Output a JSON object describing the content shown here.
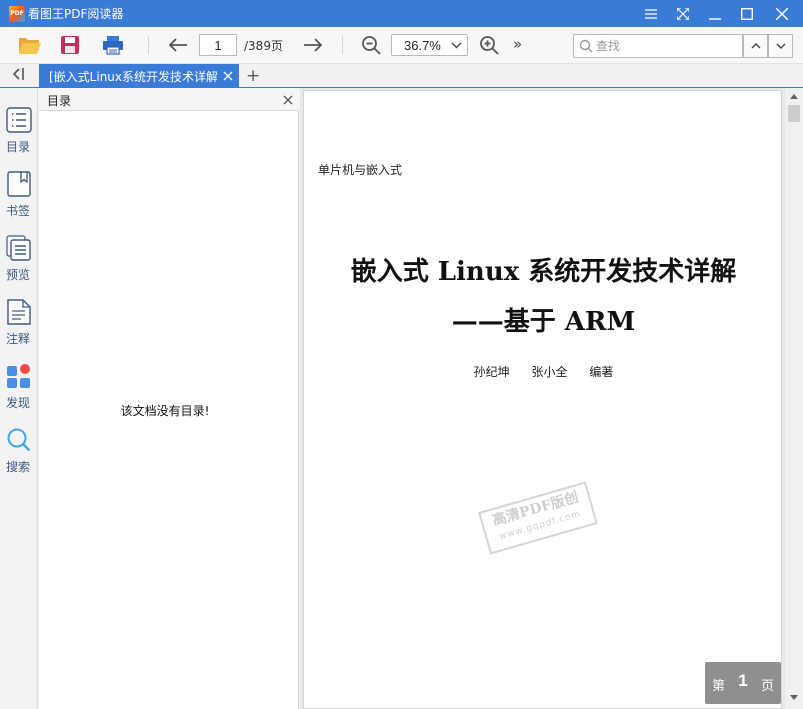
{
  "app": {
    "title": "看图王PDF阅读器",
    "logo_text": "PDF",
    "accent_color": "#3b7bd8"
  },
  "window_controls": [
    "menu-icon",
    "fullscreen-icon",
    "minimize-icon",
    "maximize-icon",
    "close-icon"
  ],
  "toolbar": {
    "icons": [
      "open-folder-icon",
      "save-icon",
      "print-icon",
      "arrow-left-icon",
      "arrow-right-icon",
      "zoom-out-icon",
      "zoom-in-icon"
    ],
    "current_page": "1",
    "total_pages": "/389页",
    "zoom": "36.7%",
    "more": "»",
    "search_placeholder": "查找"
  },
  "tabs": {
    "active_label": "[嵌入式Linux系统开发技术详解:",
    "new_tab": "+"
  },
  "sidebar": {
    "items": [
      {
        "label": "目录",
        "icon": "toc-list-icon"
      },
      {
        "label": "书签",
        "icon": "bookmark-icon"
      },
      {
        "label": "预览",
        "icon": "preview-pages-icon"
      },
      {
        "label": "注释",
        "icon": "annotation-icon"
      },
      {
        "label": "发现",
        "icon": "discover-grid-icon"
      },
      {
        "label": "搜索",
        "icon": "search-icon"
      }
    ]
  },
  "toc_panel": {
    "title": "目录",
    "empty_message": "该文档没有目录!"
  },
  "document": {
    "series": "单片机与嵌入式",
    "title": "嵌入式 Linux 系统开发技术详解",
    "subtitle": "——基于 ARM",
    "authors": [
      "孙纪坤",
      "张小全",
      "编著"
    ],
    "watermark_main": "高清PDF版创",
    "watermark_sub": "www.gqpdf.com"
  },
  "page_indicator": {
    "prefix": "第",
    "number": "1",
    "suffix": "页"
  }
}
